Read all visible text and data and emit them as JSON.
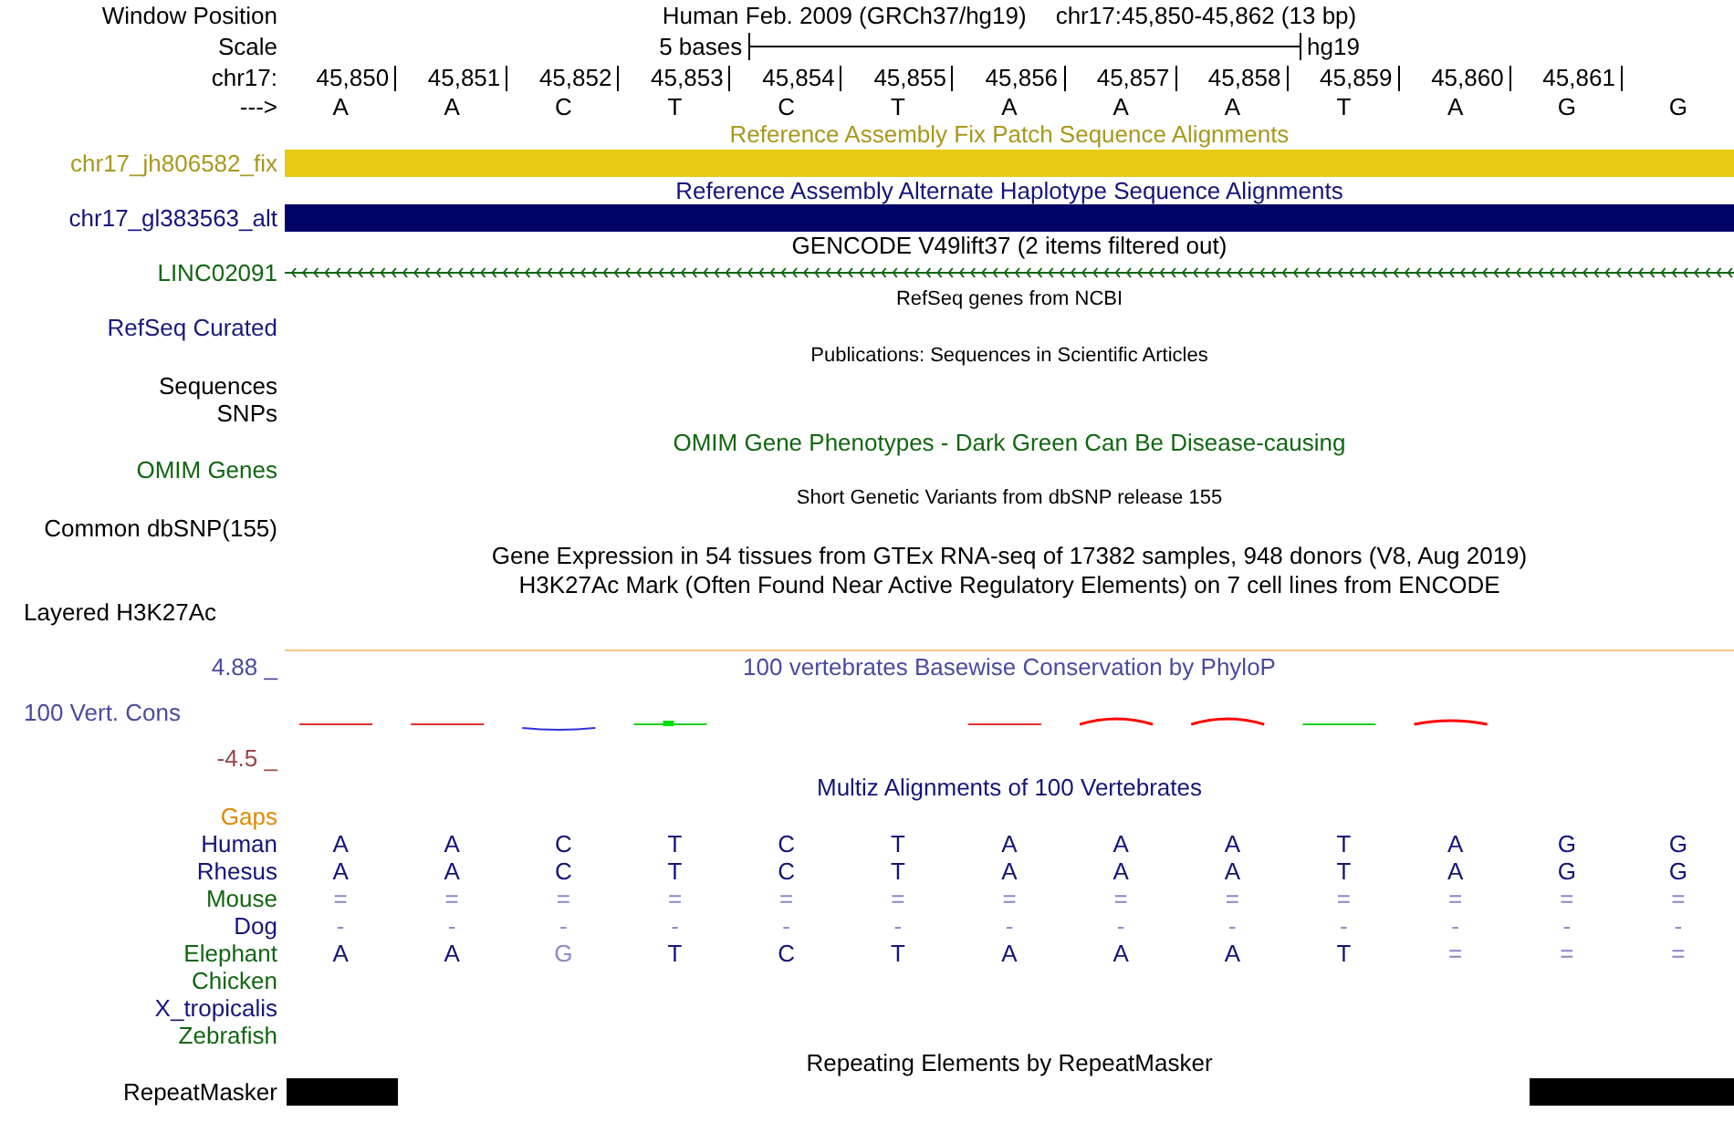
{
  "window_position": {
    "label": "Window Position",
    "assembly": "Human Feb. 2009 (GRCh37/hg19)",
    "position": "chr17:45,850-45,862 (13 bp)"
  },
  "scale": {
    "label": "Scale",
    "span": "5 bases",
    "assembly": "hg19"
  },
  "ruler": {
    "label": "chr17:",
    "positions": [
      "45,850",
      "45,851",
      "45,852",
      "45,853",
      "45,854",
      "45,855",
      "45,856",
      "45,857",
      "45,858",
      "45,859",
      "45,860",
      "45,861"
    ],
    "strand_label": "--->",
    "bases": [
      "A",
      "A",
      "C",
      "T",
      "C",
      "T",
      "A",
      "A",
      "A",
      "T",
      "A",
      "G",
      "G"
    ]
  },
  "tracks": [
    {
      "kind": "title",
      "text": "Reference Assembly Fix Patch Sequence Alignments",
      "color": "#a8981e",
      "small": false
    },
    {
      "kind": "bar",
      "label": "chr17_jh806582_fix",
      "color": "#a8981e",
      "feature": {
        "color": "#e8cb15"
      }
    },
    {
      "kind": "title",
      "text": "Reference Assembly Alternate Haplotype Sequence Alignments",
      "color": "#14147a",
      "small": false
    },
    {
      "kind": "bar",
      "label": "chr17_gl383563_alt",
      "color": "#14147a",
      "feature": {
        "color": "#000066"
      }
    },
    {
      "kind": "title",
      "text": "GENCODE V49lift37 (2 items filtered out)",
      "color": "#000000",
      "small": false
    },
    {
      "kind": "gene",
      "label": "LINC02091",
      "color": "#116611",
      "reverse": true
    },
    {
      "kind": "title",
      "text": "RefSeq genes from NCBI",
      "color": "#000000",
      "small": true
    },
    {
      "kind": "label",
      "label": "RefSeq Curated",
      "color": "#1a1a7a",
      "left_aligned": false
    },
    {
      "kind": "title",
      "text": "Publications: Sequences in Scientific Articles",
      "color": "#000000",
      "small": true
    },
    {
      "kind": "label",
      "label": "Sequences",
      "color": "#000000",
      "left_aligned": false
    },
    {
      "kind": "label",
      "label": "SNPs",
      "color": "#000000",
      "left_aligned": false
    },
    {
      "kind": "title",
      "text": "OMIM Gene Phenotypes - Dark Green Can Be Disease-causing",
      "color": "#116611",
      "small": false
    },
    {
      "kind": "label",
      "label": "OMIM Genes",
      "color": "#116611",
      "left_aligned": false
    },
    {
      "kind": "title",
      "text": "Short Genetic Variants from dbSNP release 155",
      "color": "#000000",
      "small": true
    },
    {
      "kind": "label",
      "label": "Common dbSNP(155)",
      "color": "#000000",
      "left_aligned": false
    },
    {
      "kind": "title",
      "text": "Gene Expression in 54 tissues from GTEx RNA-seq of 17382 samples, 948 donors (V8, Aug 2019)",
      "color": "#000000",
      "small": false
    },
    {
      "kind": "title",
      "text": "H3K27Ac Mark (Often Found Near Active Regulatory Elements) on 7 cell lines from ENCODE",
      "color": "#000000",
      "small": false
    },
    {
      "kind": "label",
      "label": "Layered H3K27Ac",
      "color": "#000000",
      "left_aligned": true
    },
    {
      "kind": "wiggle",
      "title": "100 vertebrates Basewise Conservation by PhyloP",
      "label": "100 Vert. Cons",
      "color": "#4a4aa0",
      "axis": [
        {
          "text": "4.88 _",
          "color": "#4a4aa0"
        },
        {
          "text": "-4.5 _",
          "color": "#994444"
        }
      ]
    },
    {
      "kind": "title",
      "text": "Multiz Alignments of 100 Vertebrates",
      "color": "#14147a",
      "small": false
    },
    {
      "kind": "label",
      "label": "Gaps",
      "color": "#e08a00",
      "left_aligned": false
    },
    {
      "kind": "align",
      "label": "Human",
      "color": "#14147a",
      "bases": [
        "A",
        "A",
        "C",
        "T",
        "C",
        "T",
        "A",
        "A",
        "A",
        "T",
        "A",
        "G",
        "G"
      ]
    },
    {
      "kind": "align",
      "label": "Rhesus",
      "color": "#14147a",
      "bases": [
        "A",
        "A",
        "C",
        "T",
        "C",
        "T",
        "A",
        "A",
        "A",
        "T",
        "A",
        "G",
        "G"
      ]
    },
    {
      "kind": "align",
      "label": "Mouse",
      "color": "#116611",
      "bases": [
        "=",
        "=",
        "=",
        "=",
        "=",
        "=",
        "=",
        "=",
        "=",
        "=",
        "=",
        "=",
        "="
      ]
    },
    {
      "kind": "align",
      "label": "Dog",
      "color": "#14147a",
      "bases": [
        "-",
        "-",
        "-",
        "-",
        "-",
        "-",
        "-",
        "-",
        "-",
        "-",
        "-",
        "-",
        "-"
      ]
    },
    {
      "kind": "align",
      "label": "Elephant",
      "color": "#116611",
      "bases": [
        "A",
        "A",
        "G",
        "T",
        "C",
        "T",
        "A",
        "A",
        "A",
        "T",
        "=",
        "=",
        "="
      ]
    },
    {
      "kind": "align",
      "label": "Chicken",
      "color": "#116611"
    },
    {
      "kind": "align",
      "label": "X_tropicalis",
      "color": "#14147a"
    },
    {
      "kind": "align",
      "label": "Zebrafish",
      "color": "#116611"
    },
    {
      "kind": "title",
      "text": "Repeating Elements by RepeatMasker",
      "color": "#000000",
      "small": false
    },
    {
      "kind": "repeat",
      "label": "RepeatMasker",
      "color": "#000000",
      "masked": [
        true,
        false,
        false,
        false,
        false,
        false,
        false,
        false,
        false,
        false,
        false,
        true,
        true
      ]
    }
  ]
}
